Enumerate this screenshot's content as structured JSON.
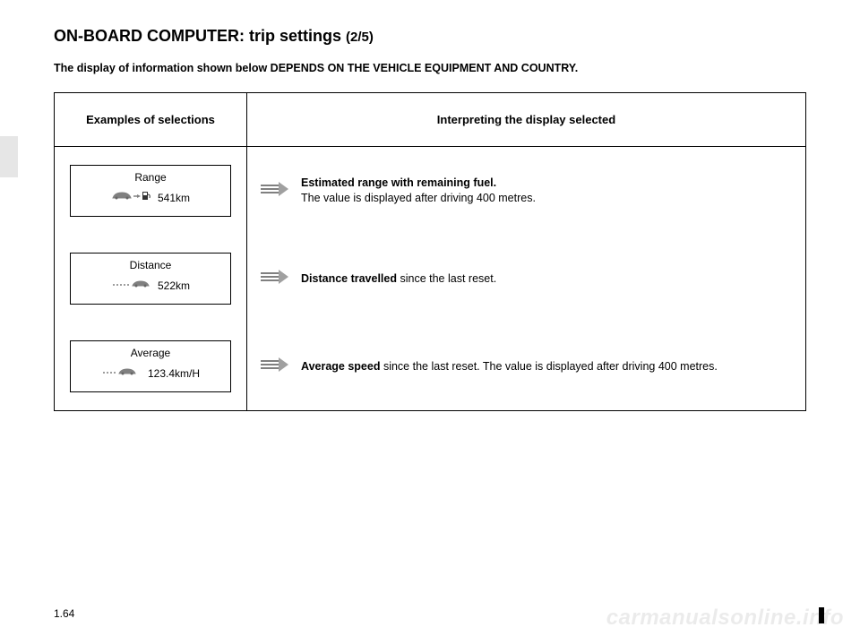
{
  "header": {
    "title": "ON-BOARD COMPUTER: trip settings ",
    "page_indicator": "(2/5)"
  },
  "note": "The display of information shown below DEPENDS ON THE VEHICLE EQUIPMENT AND COUNTRY.",
  "table": {
    "headers": {
      "examples": "Examples of selections",
      "interpreting": "Interpreting the display selected"
    },
    "rows": [
      {
        "display": {
          "label": "Range",
          "value": "541km"
        },
        "interpret": {
          "lead": "Estimated range with remaining fuel.",
          "rest": " The value is displayed after driving 400 metres."
        }
      },
      {
        "display": {
          "label": "Distance",
          "value": "522km"
        },
        "interpret": {
          "lead": "Distance travelled",
          "rest": " since the last reset."
        }
      },
      {
        "display": {
          "label": "Average",
          "value": "123.4km/H"
        },
        "interpret": {
          "lead": "Average speed",
          "rest": " since the last reset. The value is displayed after driving 400 metres."
        }
      }
    ]
  },
  "page_number": "1.64",
  "watermark": "carmanualsonline.info"
}
